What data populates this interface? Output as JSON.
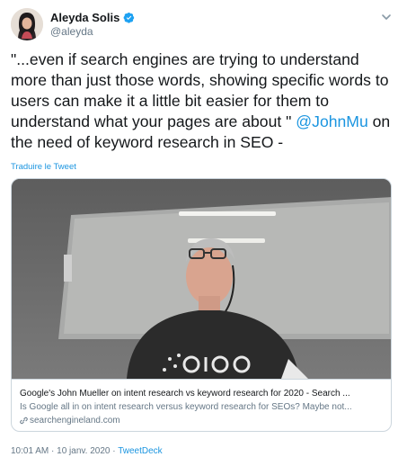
{
  "author": {
    "display_name": "Aleyda Solis",
    "handle": "@aleyda",
    "verified": true
  },
  "tweet": {
    "text_before": "\"...even if search engines are trying to understand more than just those words, showing specific words to users can make it a little bit easier for them to understand what your pages are about \" ",
    "mention": "@JohnMu",
    "text_after": " on the need of keyword research in SEO -",
    "translate_label": "Traduire le Tweet"
  },
  "card": {
    "title": "Google's John Mueller on intent research vs keyword research for 2020 - Search ...",
    "description": "Is Google all in on intent research versus keyword research for SEOs? Maybe not...",
    "domain": "searchengineland.com"
  },
  "meta": {
    "time": "10:01 AM",
    "separator": " · ",
    "date": "10 janv. 2020",
    "separator2": " · ",
    "source": "TweetDeck"
  },
  "icons": {
    "verified": "verified-badge-icon",
    "chevron": "chevron-down-icon",
    "link": "link-icon"
  },
  "colors": {
    "accent": "#1b95e0",
    "text": "#14171a",
    "secondary": "#657786",
    "border": "#ccd6dd"
  }
}
